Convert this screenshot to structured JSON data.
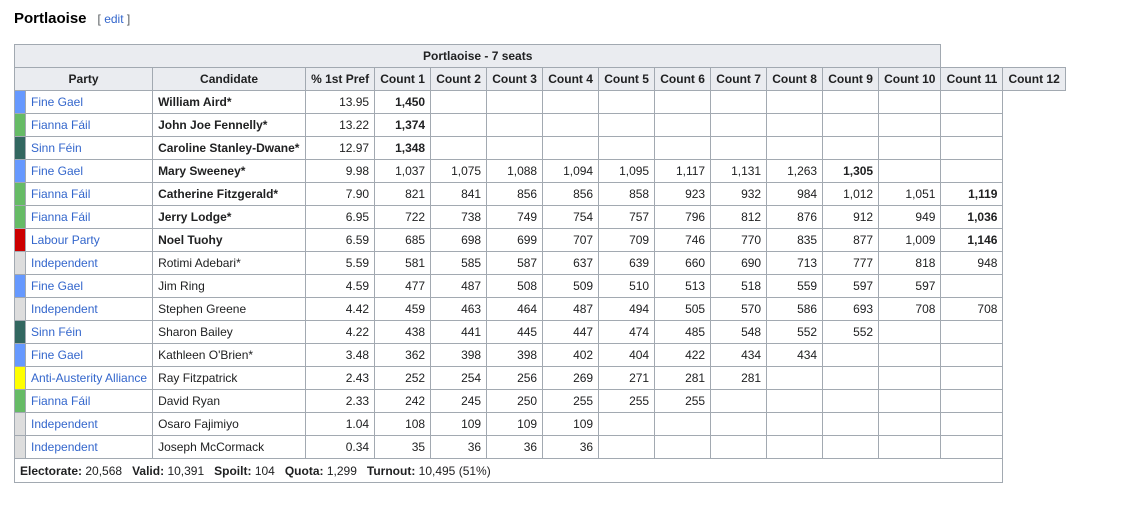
{
  "section": {
    "title": "Portlaoise",
    "edit_open": "[ ",
    "edit_label": "edit",
    "edit_close": " ]"
  },
  "table": {
    "caption": "Portlaoise - 7 seats",
    "headers": {
      "party": "Party",
      "candidate": "Candidate",
      "pref": "% 1st Pref",
      "counts": [
        "Count 1",
        "Count 2",
        "Count 3",
        "Count 4",
        "Count 5",
        "Count 6",
        "Count 7",
        "Count 8",
        "Count 9",
        "Count 10",
        "Count 11",
        "Count 12"
      ]
    },
    "party_colors": {
      "Fine Gael": "#6699ff",
      "Fianna Fáil": "#66bb66",
      "Sinn Féin": "#326760",
      "Labour Party": "#cc0000",
      "Independent": "#dddddd",
      "Anti-Austerity Alliance": "#ffff00"
    },
    "rows": [
      {
        "party": "Fine Gael",
        "candidate": "William Aird*",
        "elected": true,
        "pref": "13.95",
        "counts": [
          "1,450",
          "",
          "",
          "",
          "",
          "",
          "",
          "",
          "",
          "",
          "",
          ""
        ],
        "bold_count": 0
      },
      {
        "party": "Fianna Fáil",
        "candidate": "John Joe Fennelly*",
        "elected": true,
        "pref": "13.22",
        "counts": [
          "1,374",
          "",
          "",
          "",
          "",
          "",
          "",
          "",
          "",
          "",
          "",
          ""
        ],
        "bold_count": 0
      },
      {
        "party": "Sinn Féin",
        "candidate": "Caroline Stanley-Dwane*",
        "elected": true,
        "pref": "12.97",
        "counts": [
          "1,348",
          "",
          "",
          "",
          "",
          "",
          "",
          "",
          "",
          "",
          "",
          ""
        ],
        "bold_count": 0
      },
      {
        "party": "Fine Gael",
        "candidate": "Mary Sweeney*",
        "elected": true,
        "pref": "9.98",
        "counts": [
          "1,037",
          "1,075",
          "1,088",
          "1,094",
          "1,095",
          "1,117",
          "1,131",
          "1,263",
          "1,305",
          "",
          "",
          ""
        ],
        "bold_count": 8
      },
      {
        "party": "Fianna Fáil",
        "candidate": "Catherine Fitzgerald*",
        "elected": true,
        "pref": "7.90",
        "counts": [
          "821",
          "841",
          "856",
          "856",
          "858",
          "923",
          "932",
          "984",
          "1,012",
          "1,051",
          "1,119",
          ""
        ],
        "bold_count": 10
      },
      {
        "party": "Fianna Fáil",
        "candidate": "Jerry Lodge*",
        "elected": true,
        "pref": "6.95",
        "counts": [
          "722",
          "738",
          "749",
          "754",
          "757",
          "796",
          "812",
          "876",
          "912",
          "949",
          "1,036",
          ""
        ],
        "bold_count": 10
      },
      {
        "party": "Labour Party",
        "candidate": "Noel Tuohy",
        "elected": true,
        "pref": "6.59",
        "counts": [
          "685",
          "698",
          "699",
          "707",
          "709",
          "746",
          "770",
          "835",
          "877",
          "1,009",
          "1,146",
          ""
        ],
        "bold_count": 10
      },
      {
        "party": "Independent",
        "candidate": "Rotimi Adebari*",
        "elected": false,
        "pref": "5.59",
        "counts": [
          "581",
          "585",
          "587",
          "637",
          "639",
          "660",
          "690",
          "713",
          "777",
          "818",
          "948",
          ""
        ],
        "bold_count": -1
      },
      {
        "party": "Fine Gael",
        "candidate": "Jim Ring",
        "elected": false,
        "pref": "4.59",
        "counts": [
          "477",
          "487",
          "508",
          "509",
          "510",
          "513",
          "518",
          "559",
          "597",
          "597",
          "",
          ""
        ],
        "bold_count": -1
      },
      {
        "party": "Independent",
        "candidate": "Stephen Greene",
        "elected": false,
        "pref": "4.42",
        "counts": [
          "459",
          "463",
          "464",
          "487",
          "494",
          "505",
          "570",
          "586",
          "693",
          "708",
          "708",
          ""
        ],
        "bold_count": -1
      },
      {
        "party": "Sinn Féin",
        "candidate": "Sharon Bailey",
        "elected": false,
        "pref": "4.22",
        "counts": [
          "438",
          "441",
          "445",
          "447",
          "474",
          "485",
          "548",
          "552",
          "552",
          "",
          "",
          ""
        ],
        "bold_count": -1
      },
      {
        "party": "Fine Gael",
        "candidate": "Kathleen O'Brien*",
        "elected": false,
        "pref": "3.48",
        "counts": [
          "362",
          "398",
          "398",
          "402",
          "404",
          "422",
          "434",
          "434",
          "",
          "",
          "",
          ""
        ],
        "bold_count": -1
      },
      {
        "party": "Anti-Austerity Alliance",
        "candidate": "Ray Fitzpatrick",
        "elected": false,
        "pref": "2.43",
        "counts": [
          "252",
          "254",
          "256",
          "269",
          "271",
          "281",
          "281",
          "",
          "",
          "",
          "",
          ""
        ],
        "bold_count": -1
      },
      {
        "party": "Fianna Fáil",
        "candidate": "David Ryan",
        "elected": false,
        "pref": "2.33",
        "counts": [
          "242",
          "245",
          "250",
          "255",
          "255",
          "255",
          "",
          "",
          "",
          "",
          "",
          ""
        ],
        "bold_count": -1
      },
      {
        "party": "Independent",
        "candidate": "Osaro Fajimiyo",
        "elected": false,
        "pref": "1.04",
        "counts": [
          "108",
          "109",
          "109",
          "109",
          "",
          "",
          "",
          "",
          "",
          "",
          "",
          ""
        ],
        "bold_count": -1
      },
      {
        "party": "Independent",
        "candidate": "Joseph McCormack",
        "elected": false,
        "pref": "0.34",
        "counts": [
          "35",
          "36",
          "36",
          "36",
          "",
          "",
          "",
          "",
          "",
          "",
          "",
          ""
        ],
        "bold_count": -1
      }
    ],
    "footer": [
      {
        "label": "Electorate:",
        "value": "20,568"
      },
      {
        "label": "Valid:",
        "value": "10,391"
      },
      {
        "label": "Spoilt:",
        "value": "104"
      },
      {
        "label": "Quota:",
        "value": "1,299"
      },
      {
        "label": "Turnout:",
        "value": "10,495 (51%)"
      }
    ]
  }
}
